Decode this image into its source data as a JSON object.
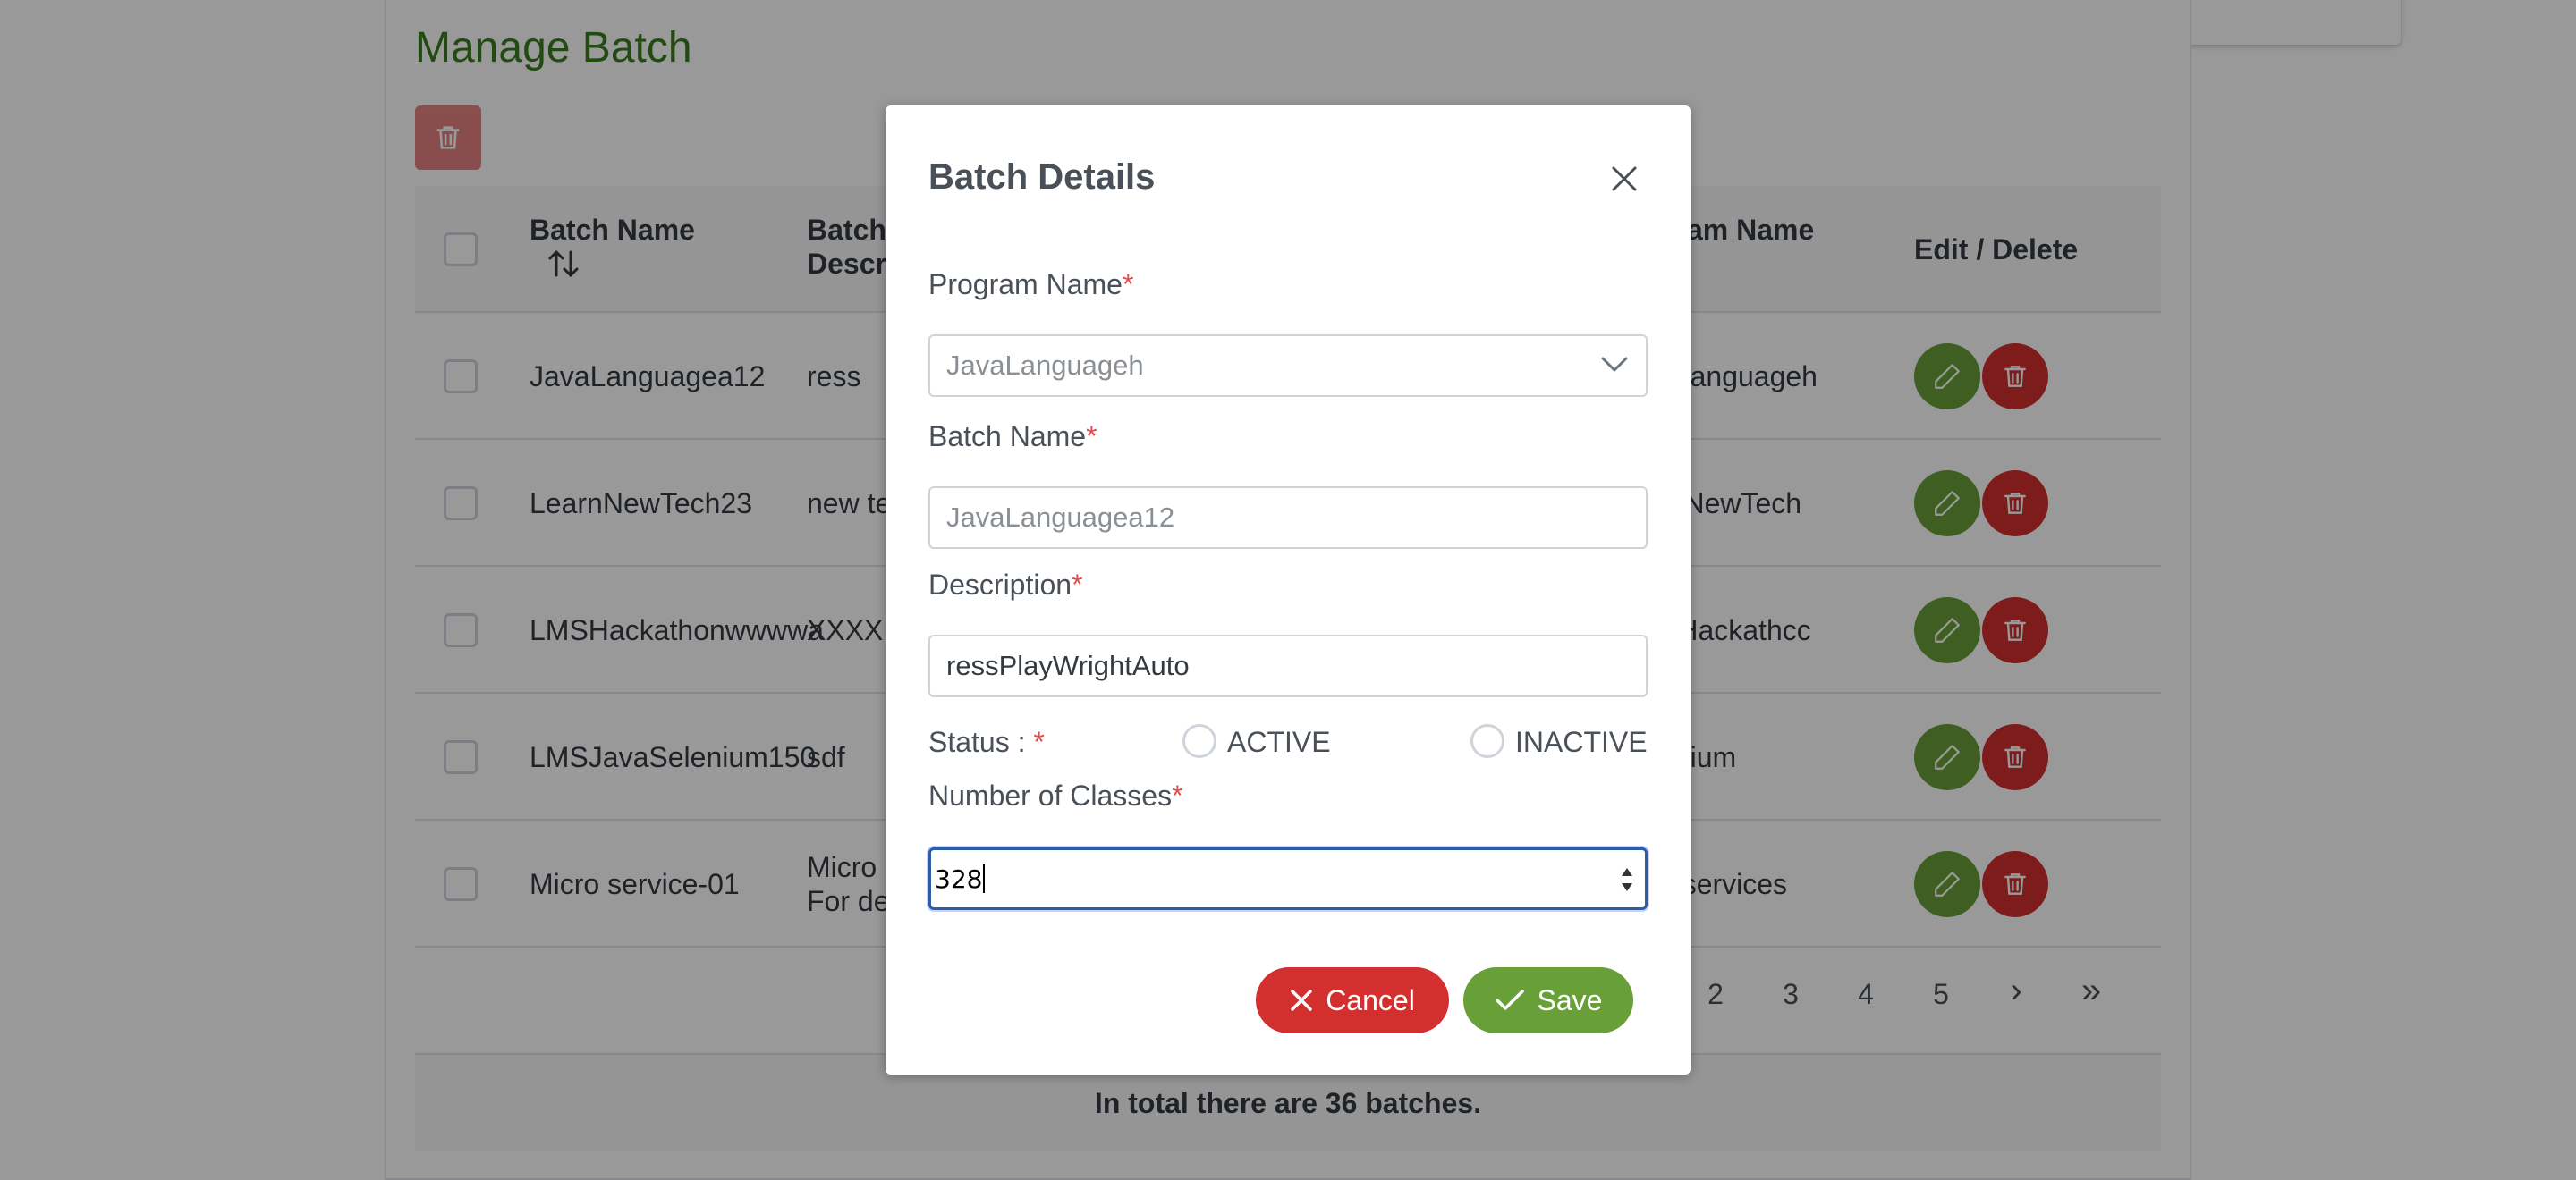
{
  "page": {
    "title": "Manage Batch",
    "table": {
      "headers": {
        "batch_name": "Batch Name",
        "batch_desc_line1": "Batch",
        "batch_desc_line2": "Descr",
        "program_name": "gram Name",
        "edit_delete": "Edit / Delete"
      },
      "sort_icon": "sort-icon",
      "rows": [
        {
          "batch_name": "JavaLanguagea12",
          "description": "ress",
          "description2": "",
          "program": "aLanguageh"
        },
        {
          "batch_name": "LearnNewTech23",
          "description": "new te",
          "description2": "",
          "program": "rnNewTech"
        },
        {
          "batch_name": "LMSHackathonwwwwa",
          "description": "XXXX",
          "description2": "",
          "program": "SHackathcc"
        },
        {
          "batch_name": "LMSJavaSelenium150",
          "description": "sdf",
          "description2": "",
          "program": "enium"
        },
        {
          "batch_name": "Micro service-01",
          "description": "Micro",
          "description2": "For de",
          "program": "o services"
        }
      ]
    },
    "paginator": {
      "pages": [
        "2",
        "3",
        "4",
        "5"
      ],
      "next": "›",
      "last": "»"
    },
    "footer": "In total there are 36 batches."
  },
  "dialog": {
    "title": "Batch Details",
    "program_name": {
      "label": "Program Name",
      "required": "*",
      "value": "JavaLanguageh"
    },
    "batch_name": {
      "label": "Batch Name",
      "required": "*",
      "value": "JavaLanguagea12"
    },
    "description": {
      "label": "Description",
      "required": "*",
      "value": "ressPlayWrightAuto"
    },
    "status": {
      "label": "Status : ",
      "required": "*",
      "options": [
        "ACTIVE",
        "INACTIVE"
      ]
    },
    "num_classes": {
      "label": "Number of Classes",
      "required": "*",
      "value": "328"
    },
    "cancel_label": "Cancel",
    "save_label": "Save"
  },
  "colors": {
    "green": "#689f38",
    "red": "#d32f2f",
    "title_green": "#3a7d1f",
    "focus_blue": "#2a5ea7"
  }
}
